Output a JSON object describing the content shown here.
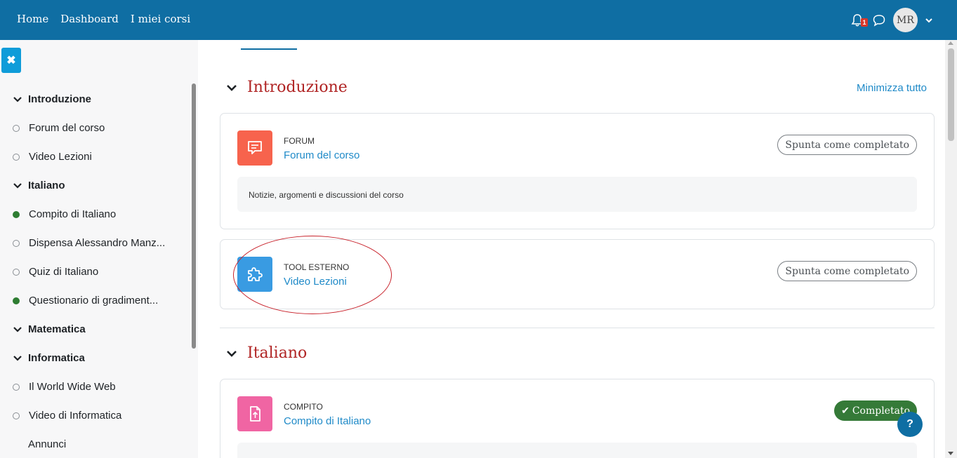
{
  "nav": {
    "links": [
      "Home",
      "Dashboard",
      "I miei corsi"
    ],
    "notification_count": "1",
    "avatar_initials": "MR"
  },
  "drawer": {
    "items": [
      {
        "type": "section",
        "label": "Introduzione"
      },
      {
        "type": "activity",
        "label": "Forum del corso",
        "done": false
      },
      {
        "type": "activity",
        "label": "Video Lezioni",
        "done": false
      },
      {
        "type": "section",
        "label": "Italiano"
      },
      {
        "type": "activity",
        "label": "Compito di Italiano",
        "done": true
      },
      {
        "type": "activity",
        "label": "Dispensa Alessandro Manz...",
        "done": false
      },
      {
        "type": "activity",
        "label": "Quiz di Italiano",
        "done": false
      },
      {
        "type": "activity",
        "label": "Questionario di gradiment...",
        "done": true
      },
      {
        "type": "section",
        "label": "Matematica"
      },
      {
        "type": "section",
        "label": "Informatica"
      },
      {
        "type": "activity",
        "label": "Il World Wide Web",
        "done": false
      },
      {
        "type": "activity",
        "label": "Video di Informatica",
        "done": false
      },
      {
        "type": "plain",
        "label": "Annunci"
      }
    ]
  },
  "main": {
    "collapse_all": "Minimizza tutto",
    "sections": [
      {
        "title": "Introduzione",
        "activities": [
          {
            "type": "FORUM",
            "name": "Forum del corso",
            "button": "Spunta come completato",
            "description": "Notizie, argomenti e discussioni del corso",
            "icon": "forum-icon",
            "color": "#f7634d"
          },
          {
            "type": "TOOL ESTERNO",
            "name": "Video Lezioni",
            "button": "Spunta come completato",
            "icon": "puzzle-icon",
            "color": "#399be2"
          }
        ]
      },
      {
        "title": "Italiano",
        "activities": [
          {
            "type": "COMPITO",
            "name": "Compito di Italiano",
            "button": "Completato",
            "icon": "assignment-icon",
            "color": "#f065a3"
          }
        ]
      }
    ]
  },
  "help": "?"
}
